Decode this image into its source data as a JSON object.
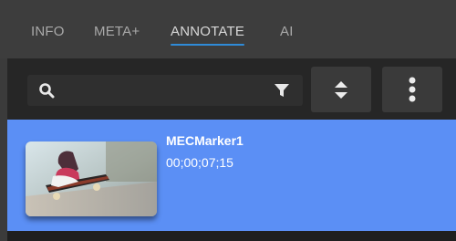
{
  "tabs": [
    {
      "label": "INFO",
      "active": false
    },
    {
      "label": "META+",
      "active": false
    },
    {
      "label": "ANNOTATE",
      "active": true
    },
    {
      "label": "AI",
      "active": false
    }
  ],
  "toolbar": {
    "search_value": "",
    "search_icon": "search-icon",
    "filter_icon": "filter-icon",
    "sort_icon": "sort-icon",
    "more_icon": "more-vertical-icon"
  },
  "markers": [
    {
      "name": "MECMarker1",
      "timecode": "00;00;07;15",
      "selected": true
    }
  ],
  "colors": {
    "accent": "#2f8bd8",
    "selected_row": "#5b8ff5",
    "panel_bg": "#262626"
  }
}
